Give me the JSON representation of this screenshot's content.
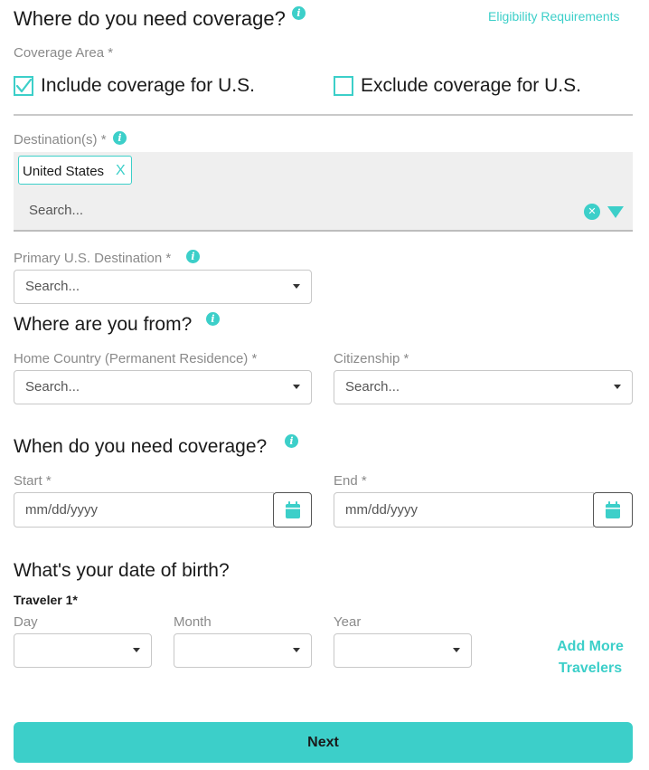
{
  "coverage": {
    "heading": "Where do you need coverage?",
    "eligibility_link": "Eligibility Requirements",
    "area_label": "Coverage Area *",
    "include_label": "Include coverage for U.S.",
    "include_checked": true,
    "exclude_label": "Exclude coverage for U.S.",
    "exclude_checked": false
  },
  "destinations": {
    "label": "Destination(s) *",
    "selected_tags": [
      {
        "label": "United States",
        "remove": "X"
      }
    ],
    "search_placeholder": "Search..."
  },
  "primary_destination": {
    "label": "Primary U.S. Destination *",
    "placeholder": "Search..."
  },
  "origin": {
    "heading": "Where are you from?",
    "home_country_label": "Home Country (Permanent Residence) *",
    "home_country_placeholder": "Search...",
    "citizenship_label": "Citizenship *",
    "citizenship_placeholder": "Search..."
  },
  "dates": {
    "heading": "When do you need coverage?",
    "start_label": "Start *",
    "start_placeholder": "mm/dd/yyyy",
    "end_label": "End *",
    "end_placeholder": "mm/dd/yyyy"
  },
  "birth": {
    "heading": "What's your date of birth?",
    "traveler_label": "Traveler 1*",
    "day_label": "Day",
    "day_value": "",
    "month_label": "Month",
    "month_value": "",
    "year_label": "Year",
    "year_value": "",
    "add_more_line1": "Add More",
    "add_more_line2": "Travelers"
  },
  "footer": {
    "next_label": "Next"
  },
  "colors": {
    "accent": "#3ccfc9",
    "field_border": "#c8c8c8",
    "multiselect_bg": "#efefef"
  }
}
